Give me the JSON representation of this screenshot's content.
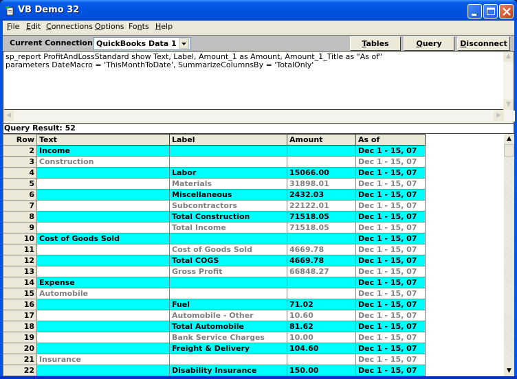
{
  "window": {
    "title": "VB Demo 32",
    "controls": [
      "minimize",
      "maximize",
      "close"
    ]
  },
  "menu": [
    {
      "label": "File",
      "mnemonic": "F"
    },
    {
      "label": "Edit",
      "mnemonic": "E"
    },
    {
      "label": "Connections",
      "mnemonic": "C"
    },
    {
      "label": "Options",
      "mnemonic": "O"
    },
    {
      "label": "Fonts",
      "mnemonic": "n"
    },
    {
      "label": "Help",
      "mnemonic": "H"
    }
  ],
  "connection": {
    "label": "Current Connection:",
    "selected": "QuickBooks Data 1"
  },
  "toolbar": {
    "tables_label": "Tables",
    "query_label": "Query",
    "disconnect_label": "Disconnect"
  },
  "query": {
    "text": "sp_report ProfitAndLossStandard show Text, Label, Amount_1 as Amount, Amount_1_Title as \"As of\"\nparameters DateMacro = 'ThisMonthToDate', SummarizeColumnsBy = 'TotalOnly'"
  },
  "result": {
    "label": "Query Result: 52",
    "columns": [
      "Row",
      "Text",
      "Label",
      "Amount",
      "As of"
    ],
    "rows": [
      {
        "row": "2",
        "text": "Income",
        "label": "",
        "amount": "",
        "asof": "Dec 1 - 15, 07",
        "style": "cyan"
      },
      {
        "row": "3",
        "text": "Construction",
        "label": "",
        "amount": "",
        "asof": "Dec 1 - 15, 07",
        "style": "white"
      },
      {
        "row": "4",
        "text": "",
        "label": "Labor",
        "amount": "15066.00",
        "asof": "Dec 1 - 15, 07",
        "style": "cyan"
      },
      {
        "row": "5",
        "text": "",
        "label": "Materials",
        "amount": "31898.01",
        "asof": "Dec 1 - 15, 07",
        "style": "white"
      },
      {
        "row": "6",
        "text": "",
        "label": "Miscellaneous",
        "amount": "2432.03",
        "asof": "Dec 1 - 15, 07",
        "style": "cyan"
      },
      {
        "row": "7",
        "text": "",
        "label": "Subcontractors",
        "amount": "22122.01",
        "asof": "Dec 1 - 15, 07",
        "style": "white"
      },
      {
        "row": "8",
        "text": "",
        "label": "Total Construction",
        "amount": "71518.05",
        "asof": "Dec 1 - 15, 07",
        "style": "cyan"
      },
      {
        "row": "9",
        "text": "",
        "label": "Total Income",
        "amount": "71518.05",
        "asof": "Dec 1 - 15, 07",
        "style": "white"
      },
      {
        "row": "10",
        "text": "Cost of Goods Sold",
        "label": "",
        "amount": "",
        "asof": "Dec 1 - 15, 07",
        "style": "cyan"
      },
      {
        "row": "11",
        "text": "",
        "label": "Cost of Goods Sold",
        "amount": "4669.78",
        "asof": "Dec 1 - 15, 07",
        "style": "white"
      },
      {
        "row": "12",
        "text": "",
        "label": "Total COGS",
        "amount": "4669.78",
        "asof": "Dec 1 - 15, 07",
        "style": "cyan"
      },
      {
        "row": "13",
        "text": "",
        "label": "Gross Profit",
        "amount": "66848.27",
        "asof": "Dec 1 - 15, 07",
        "style": "white"
      },
      {
        "row": "14",
        "text": "Expense",
        "label": "",
        "amount": "",
        "asof": "Dec 1 - 15, 07",
        "style": "cyan"
      },
      {
        "row": "15",
        "text": "Automobile",
        "label": "",
        "amount": "",
        "asof": "Dec 1 - 15, 07",
        "style": "white"
      },
      {
        "row": "16",
        "text": "",
        "label": "Fuel",
        "amount": "71.02",
        "asof": "Dec 1 - 15, 07",
        "style": "cyan"
      },
      {
        "row": "17",
        "text": "",
        "label": "Automobile - Other",
        "amount": "10.60",
        "asof": "Dec 1 - 15, 07",
        "style": "white"
      },
      {
        "row": "18",
        "text": "",
        "label": "Total Automobile",
        "amount": "81.62",
        "asof": "Dec 1 - 15, 07",
        "style": "cyan"
      },
      {
        "row": "19",
        "text": "",
        "label": "Bank Service Charges",
        "amount": "10.00",
        "asof": "Dec 1 - 15, 07",
        "style": "white"
      },
      {
        "row": "20",
        "text": "",
        "label": "Freight & Delivery",
        "amount": "104.60",
        "asof": "Dec 1 - 15, 07",
        "style": "cyan"
      },
      {
        "row": "21",
        "text": "Insurance",
        "label": "",
        "amount": "",
        "asof": "Dec 1 - 15, 07",
        "style": "white"
      },
      {
        "row": "22",
        "text": "",
        "label": "Disability Insurance",
        "amount": "150.00",
        "asof": "Dec 1 - 15, 07",
        "style": "cyan"
      }
    ]
  },
  "colors": {
    "row_highlight": "#00ffff",
    "row_dim_text": "#808080",
    "titlebar": "#0054e3"
  }
}
